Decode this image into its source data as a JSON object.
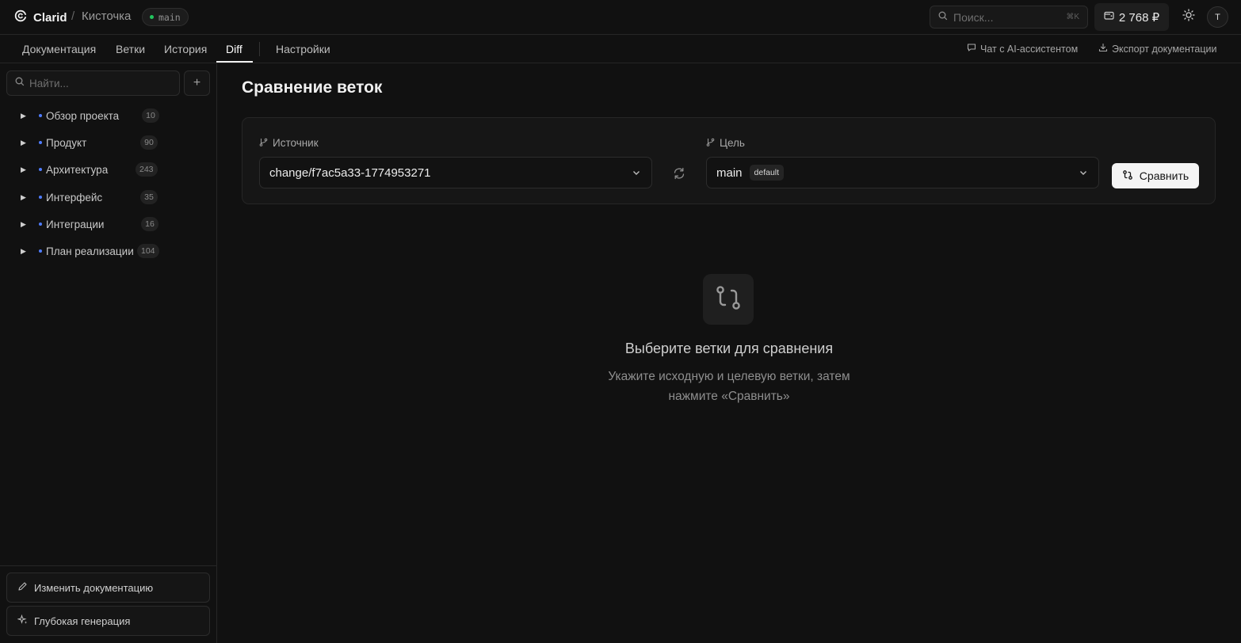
{
  "header": {
    "app_name": "Clarid",
    "separator": "/",
    "project": "Кисточка",
    "branch": "main",
    "search_placeholder": "Поиск...",
    "search_shortcut": "⌘K",
    "balance": "2 768 ₽",
    "avatar_initial": "T"
  },
  "nav": {
    "tabs": [
      {
        "label": "Документация"
      },
      {
        "label": "Ветки"
      },
      {
        "label": "История"
      },
      {
        "label": "Diff"
      },
      {
        "label": "Настройки"
      }
    ],
    "active_tab": "Diff",
    "links": {
      "chat": "Чат с AI-ассистентом",
      "export": "Экспорт документации"
    }
  },
  "sidebar": {
    "search_placeholder": "Найти...",
    "add_label": "+",
    "items": [
      {
        "label": "Обзор проекта",
        "count": "10"
      },
      {
        "label": "Продукт",
        "count": "90"
      },
      {
        "label": "Архитектура",
        "count": "243"
      },
      {
        "label": "Интерфейс",
        "count": "35"
      },
      {
        "label": "Интеграции",
        "count": "16"
      },
      {
        "label": "План реализации",
        "count": "104"
      }
    ],
    "buttons": {
      "edit": "Изменить документацию",
      "deep": "Глубокая генерация"
    }
  },
  "main": {
    "title": "Сравнение веток",
    "source": {
      "label": "Источник",
      "value": "change/f7ac5a33-1774953271"
    },
    "target": {
      "label": "Цель",
      "value": "main",
      "badge": "default"
    },
    "compare_label": "Сравнить",
    "empty": {
      "title": "Выберите ветки для сравнения",
      "desc_line1": "Укажите исходную и целевую ветки, затем",
      "desc_line2": "нажмите «Сравнить»"
    }
  },
  "colors": {
    "background": "#111111",
    "branch_dot": "#22c55e",
    "tree_dot": "#4f7cff",
    "button_bg": "#f4f4f4"
  }
}
